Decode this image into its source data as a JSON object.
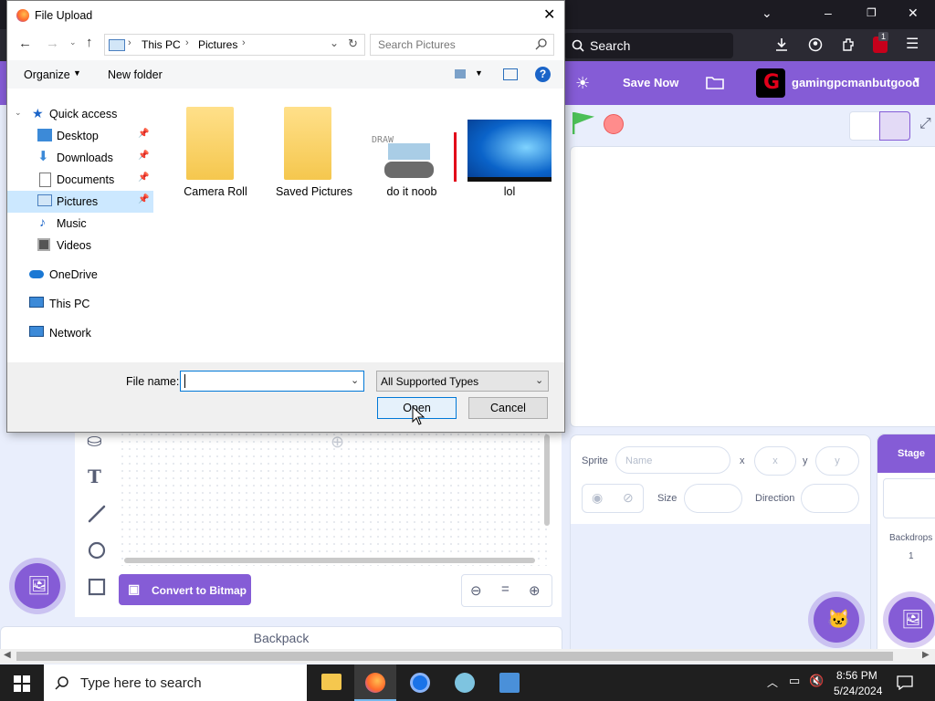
{
  "firefox": {
    "search_placeholder": "Search",
    "ext_badge": "1"
  },
  "scratch": {
    "save_now": "Save Now",
    "username": "gamingpcmanbutgood",
    "sprite_label": "Sprite",
    "name_placeholder": "Name",
    "x_label": "x",
    "x_placeholder": "x",
    "y_label": "y",
    "y_placeholder": "y",
    "size_label": "Size",
    "direction_label": "Direction",
    "stage_label": "Stage",
    "backdrops_label": "Backdrops",
    "backdrops_count": "1",
    "convert_label": "Convert to Bitmap",
    "zoom_reset": "=",
    "backpack": "Backpack",
    "brand_color": "#855cd6"
  },
  "dialog": {
    "title": "File Upload",
    "breadcrumb": [
      "This PC",
      "Pictures"
    ],
    "search_placeholder": "Search Pictures",
    "organize": "Organize",
    "new_folder": "New folder",
    "nav": {
      "quick_access": "Quick access",
      "items": [
        {
          "label": "Desktop",
          "pinned": true
        },
        {
          "label": "Downloads",
          "pinned": true
        },
        {
          "label": "Documents",
          "pinned": true
        },
        {
          "label": "Pictures",
          "pinned": true
        },
        {
          "label": "Music",
          "pinned": false
        },
        {
          "label": "Videos",
          "pinned": false
        }
      ],
      "onedrive": "OneDrive",
      "this_pc": "This PC",
      "network": "Network"
    },
    "files": [
      {
        "name": "Camera Roll",
        "type": "folder"
      },
      {
        "name": "Saved Pictures",
        "type": "folder"
      },
      {
        "name": "do it noob",
        "type": "image",
        "thumb_text": "DRAW"
      },
      {
        "name": "lol",
        "type": "image"
      }
    ],
    "file_name_label": "File name:",
    "file_name_value": "",
    "file_type": "All Supported Types",
    "open": "Open",
    "cancel": "Cancel"
  },
  "taskbar": {
    "search_placeholder": "Type here to search",
    "time": "8:56 PM",
    "date": "5/24/2024"
  }
}
